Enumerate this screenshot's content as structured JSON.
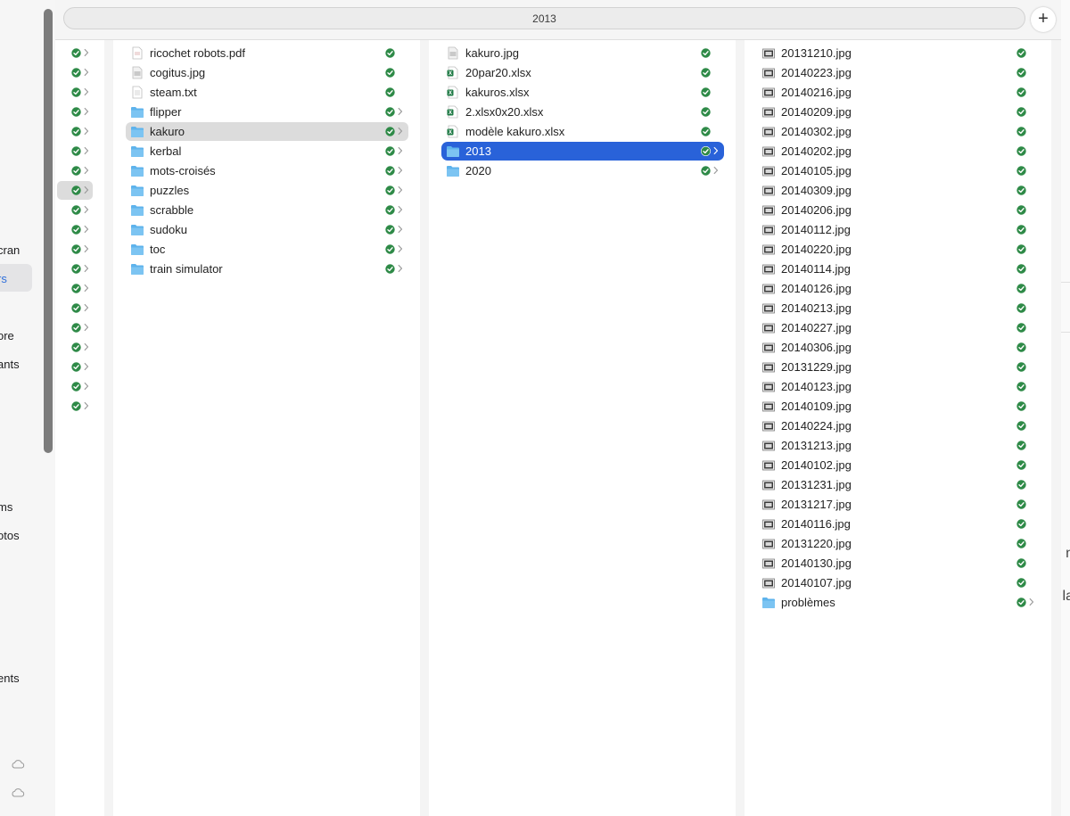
{
  "tab": {
    "title": "2013",
    "new_tab_label": "+"
  },
  "sidebar": {
    "items": [
      {
        "label": "cran"
      },
      {
        "label": "rs"
      },
      {
        "label": "ore"
      },
      {
        "label": "ants"
      },
      {
        "label": "ms"
      },
      {
        "label": "otos"
      },
      {
        "label": "ents"
      }
    ]
  },
  "right_edge": {
    "texts": [
      "n",
      "la",
      "l"
    ]
  },
  "column0": {
    "rows": 19,
    "selected_index": 7
  },
  "column1": {
    "items": [
      {
        "name": "ricochet robots.pdf",
        "icon": "pdf-file-icon"
      },
      {
        "name": "cogitus.jpg",
        "icon": "image-file-icon"
      },
      {
        "name": "steam.txt",
        "icon": "text-file-icon"
      },
      {
        "name": "flipper",
        "icon": "folder-icon"
      },
      {
        "name": "kakuro",
        "icon": "folder-icon"
      },
      {
        "name": "kerbal",
        "icon": "folder-icon"
      },
      {
        "name": "mots-croisés",
        "icon": "folder-icon"
      },
      {
        "name": "puzzles",
        "icon": "folder-icon"
      },
      {
        "name": "scrabble",
        "icon": "folder-icon"
      },
      {
        "name": "sudoku",
        "icon": "folder-icon"
      },
      {
        "name": "toc",
        "icon": "folder-icon"
      },
      {
        "name": "train simulator",
        "icon": "folder-icon"
      }
    ]
  },
  "column2": {
    "items": [
      {
        "name": "kakuro.jpg",
        "icon": "image-file-icon"
      },
      {
        "name": "20par20.xlsx",
        "icon": "excel-file-icon"
      },
      {
        "name": "kakuros.xlsx",
        "icon": "excel-file-icon"
      },
      {
        "name": "2.xlsx0x20.xlsx",
        "icon": "excel-file-icon"
      },
      {
        "name": "modèle kakuro.xlsx",
        "icon": "excel-file-icon"
      },
      {
        "name": "2013",
        "icon": "folder-icon"
      },
      {
        "name": "2020",
        "icon": "folder-icon"
      }
    ]
  },
  "column3": {
    "items": [
      {
        "name": "20131210.jpg"
      },
      {
        "name": "20140223.jpg"
      },
      {
        "name": "20140216.jpg"
      },
      {
        "name": "20140209.jpg"
      },
      {
        "name": "20140302.jpg"
      },
      {
        "name": "20140202.jpg"
      },
      {
        "name": "20140105.jpg"
      },
      {
        "name": "20140309.jpg"
      },
      {
        "name": "20140206.jpg"
      },
      {
        "name": "20140112.jpg"
      },
      {
        "name": "20140220.jpg"
      },
      {
        "name": "20140114.jpg"
      },
      {
        "name": "20140126.jpg"
      },
      {
        "name": "20140213.jpg"
      },
      {
        "name": "20140227.jpg"
      },
      {
        "name": "20140306.jpg"
      },
      {
        "name": "20131229.jpg"
      },
      {
        "name": "20140123.jpg"
      },
      {
        "name": "20140109.jpg"
      },
      {
        "name": "20140224.jpg"
      },
      {
        "name": "20131213.jpg"
      },
      {
        "name": "20140102.jpg"
      },
      {
        "name": "20131231.jpg"
      },
      {
        "name": "20131217.jpg"
      },
      {
        "name": "20140116.jpg"
      },
      {
        "name": "20131220.jpg"
      },
      {
        "name": "20140130.jpg"
      },
      {
        "name": "20140107.jpg"
      },
      {
        "name": "problèmes"
      }
    ]
  },
  "colors": {
    "accent": "#2962d9",
    "sync_green": "#2e8a47",
    "folder_blue": "#5eb3ec"
  }
}
